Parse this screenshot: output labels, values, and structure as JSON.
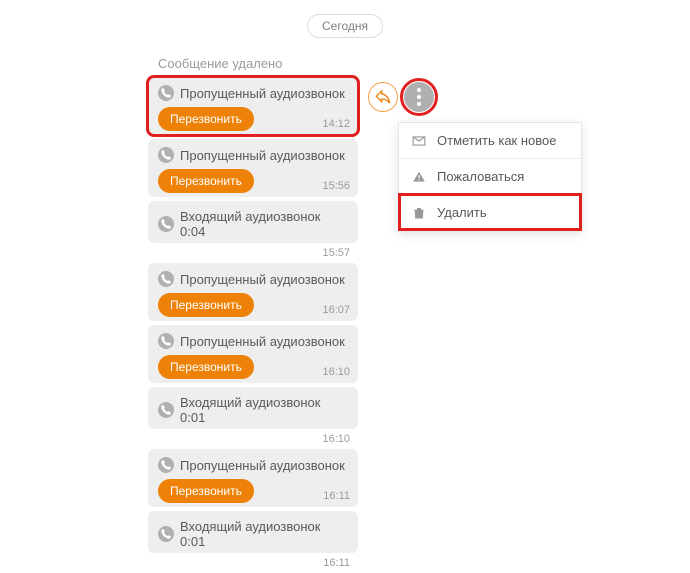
{
  "date_label": "Сегодня",
  "deleted_text": "Сообщение удалено",
  "colors": {
    "accent": "#ee8208",
    "highlight": "#e01f1f"
  },
  "messages": [
    {
      "type": "missed",
      "title": "Пропущенный аудиозвонок",
      "callback": "Перезвонить",
      "time": "14:12",
      "highlight": true
    },
    {
      "type": "missed",
      "title": "Пропущенный аудиозвонок",
      "callback": "Перезвонить",
      "time": "15:56"
    },
    {
      "type": "incoming",
      "title": "Входящий аудиозвонок 0:04",
      "time": "15:57"
    },
    {
      "type": "missed",
      "title": "Пропущенный аудиозвонок",
      "callback": "Перезвонить",
      "time": "16:07"
    },
    {
      "type": "missed",
      "title": "Пропущенный аудиозвонок",
      "callback": "Перезвонить",
      "time": "16:10"
    },
    {
      "type": "incoming",
      "title": "Входящий аудиозвонок 0:01",
      "time": "16:10"
    },
    {
      "type": "missed",
      "title": "Пропущенный аудиозвонок",
      "callback": "Перезвонить",
      "time": "16:11"
    },
    {
      "type": "incoming",
      "title": "Входящий аудиозвонок 0:01",
      "time": "16:11"
    }
  ],
  "menu": {
    "mark_new": "Отметить как новое",
    "report": "Пожаловаться",
    "delete": "Удалить"
  }
}
